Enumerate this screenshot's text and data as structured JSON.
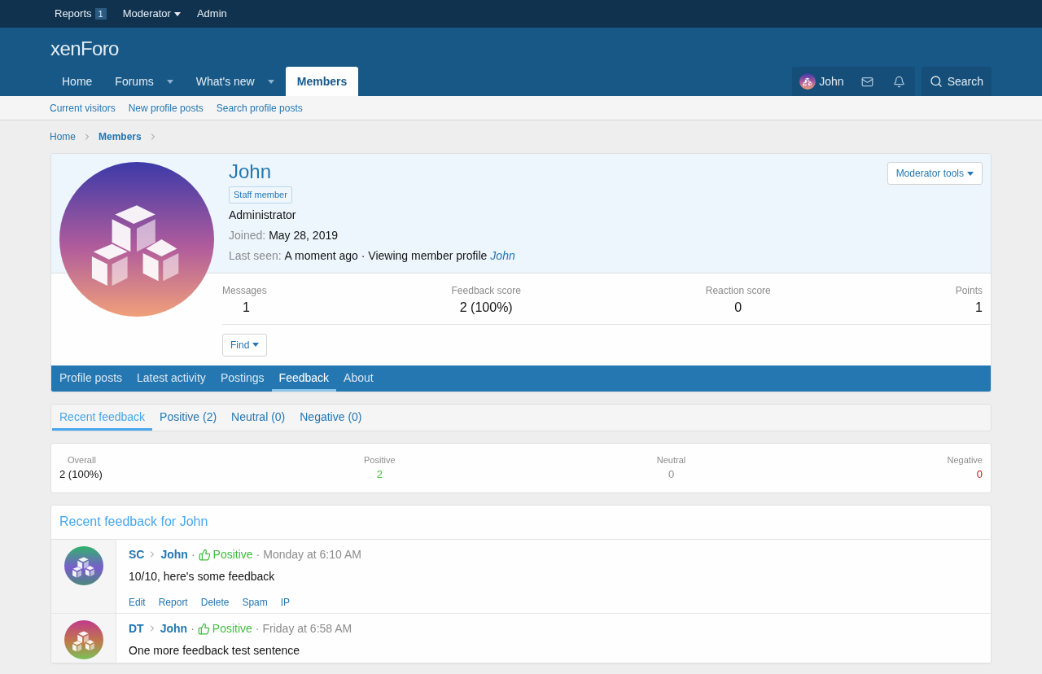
{
  "top_bar": {
    "items": [
      {
        "label": "Reports",
        "badge": "1",
        "dropdown": false
      },
      {
        "label": "Moderator",
        "dropdown": true
      },
      {
        "label": "Admin",
        "dropdown": false
      }
    ]
  },
  "logo": "xenForo",
  "nav": {
    "tabs": [
      {
        "label": "Home",
        "dropdown": false,
        "selected": false
      },
      {
        "label": "Forums",
        "dropdown": true,
        "selected": false
      },
      {
        "label": "What's new",
        "dropdown": true,
        "selected": false
      },
      {
        "label": "Members",
        "dropdown": false,
        "selected": true
      }
    ],
    "user": "John",
    "search": "Search"
  },
  "sub_nav": [
    "Current visitors",
    "New profile posts",
    "Search profile posts"
  ],
  "breadcrumb": [
    "Home",
    "Members"
  ],
  "profile": {
    "name": "John",
    "banner": "Staff member",
    "title": "Administrator",
    "joined_label": "Joined:",
    "joined": "May 28, 2019",
    "last_seen_label": "Last seen:",
    "last_seen": "A moment ago · Viewing member profile",
    "last_seen_link": "John",
    "moderator_tools": "Moderator tools",
    "stats": [
      {
        "label": "Messages",
        "value": "1"
      },
      {
        "label": "Feedback score",
        "value": "2 (100%)"
      },
      {
        "label": "Reaction score",
        "value": "0"
      },
      {
        "label": "Points",
        "value": "1"
      }
    ],
    "find": "Find",
    "tabs": [
      {
        "label": "Profile posts",
        "selected": false
      },
      {
        "label": "Latest activity",
        "selected": false
      },
      {
        "label": "Postings",
        "selected": false
      },
      {
        "label": "Feedback",
        "selected": true
      },
      {
        "label": "About",
        "selected": false
      }
    ]
  },
  "feedback_tabs": [
    {
      "label": "Recent feedback",
      "selected": true
    },
    {
      "label": "Positive (2)",
      "selected": false
    },
    {
      "label": "Neutral (0)",
      "selected": false
    },
    {
      "label": "Negative (0)",
      "selected": false
    }
  ],
  "summary": [
    {
      "label": "Overall",
      "value": "2 (100%)",
      "kind": "overall"
    },
    {
      "label": "Positive",
      "value": "2",
      "kind": "positive"
    },
    {
      "label": "Neutral",
      "value": "0",
      "kind": "neutral"
    },
    {
      "label": "Negative",
      "value": "0",
      "kind": "negative"
    }
  ],
  "recent": {
    "title": "Recent feedback for John",
    "items": [
      {
        "from": "SC",
        "to": "John",
        "rating": "Positive",
        "kind": "positive",
        "time": "Monday at 6:10 AM",
        "text": "10/10, here's some feedback",
        "actions": [
          "Edit",
          "Report",
          "Delete",
          "Spam",
          "IP"
        ]
      },
      {
        "from": "DT",
        "to": "John",
        "rating": "Positive",
        "kind": "positive",
        "time": "Friday at 6:58 AM",
        "text": "One more feedback test sentence"
      }
    ]
  },
  "separator": "·"
}
